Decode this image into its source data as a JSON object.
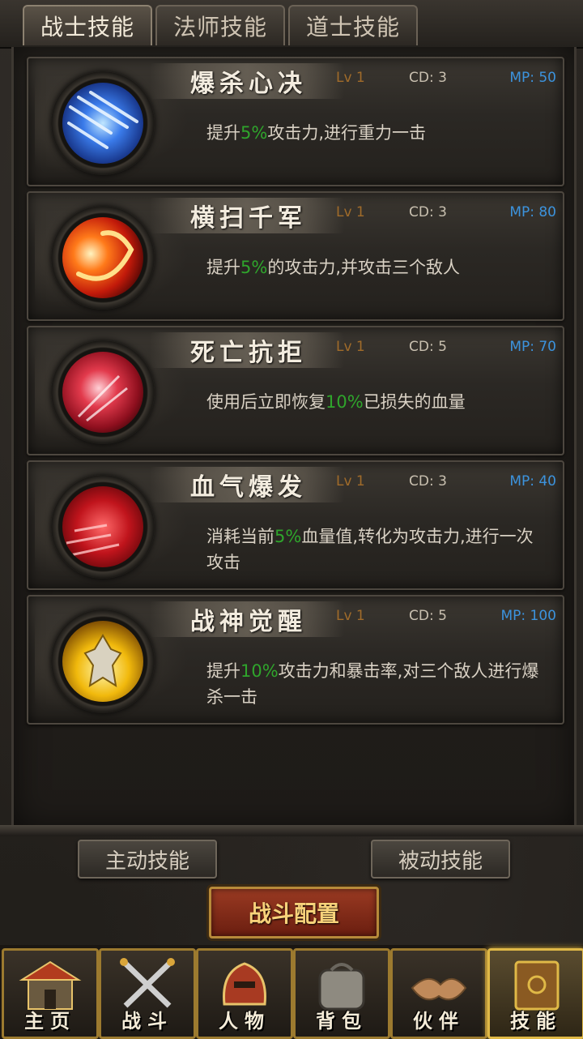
{
  "tabs": [
    {
      "label": "战士技能",
      "active": true
    },
    {
      "label": "法师技能",
      "active": false
    },
    {
      "label": "道士技能",
      "active": false
    }
  ],
  "skills": [
    {
      "name": "爆杀心决",
      "level": "Lv 1",
      "cd": "CD: 3",
      "mp": "MP: 50",
      "desc_pre": "提升",
      "desc_hl": "5%",
      "desc_post": "攻击力,进行重力一击",
      "icon": "blue-slash-icon"
    },
    {
      "name": "横扫千军",
      "level": "Lv 1",
      "cd": "CD: 3",
      "mp": "MP: 80",
      "desc_pre": "提升",
      "desc_hl": "5%",
      "desc_post": "的攻击力,并攻击三个敌人",
      "icon": "fire-sweep-icon"
    },
    {
      "name": "死亡抗拒",
      "level": "Lv 1",
      "cd": "CD: 5",
      "mp": "MP: 70",
      "desc_pre": "使用后立即恢复",
      "desc_hl": "10%",
      "desc_post": "已损失的血量",
      "icon": "red-burst-icon"
    },
    {
      "name": "血气爆发",
      "level": "Lv 1",
      "cd": "CD: 3",
      "mp": "MP: 40",
      "desc_pre": "消耗当前",
      "desc_hl": "5%",
      "desc_post": "血量值,转化为攻击力,进行一次攻击",
      "icon": "blood-surge-icon"
    },
    {
      "name": "战神觉醒",
      "level": "Lv 1",
      "cd": "CD: 5",
      "mp": "MP: 100",
      "desc_pre": "提升",
      "desc_hl": "10%",
      "desc_post": "攻击力和暴击率,对三个敌人进行爆杀一击",
      "icon": "golden-warrior-icon"
    }
  ],
  "buttons": {
    "active_skills": "主动技能",
    "passive_skills": "被动技能",
    "battle_config": "战斗配置"
  },
  "nav": [
    {
      "label": "主页",
      "icon": "palace-icon"
    },
    {
      "label": "战斗",
      "icon": "crossed-swords-icon"
    },
    {
      "label": "人物",
      "icon": "helmet-icon"
    },
    {
      "label": "背包",
      "icon": "bag-icon"
    },
    {
      "label": "伙伴",
      "icon": "handshake-icon"
    },
    {
      "label": "技能",
      "icon": "skill-book-icon",
      "active": true
    }
  ],
  "colors": {
    "highlight": "#2fa52c",
    "mp": "#3c93dd",
    "level": "#a06b2a"
  }
}
